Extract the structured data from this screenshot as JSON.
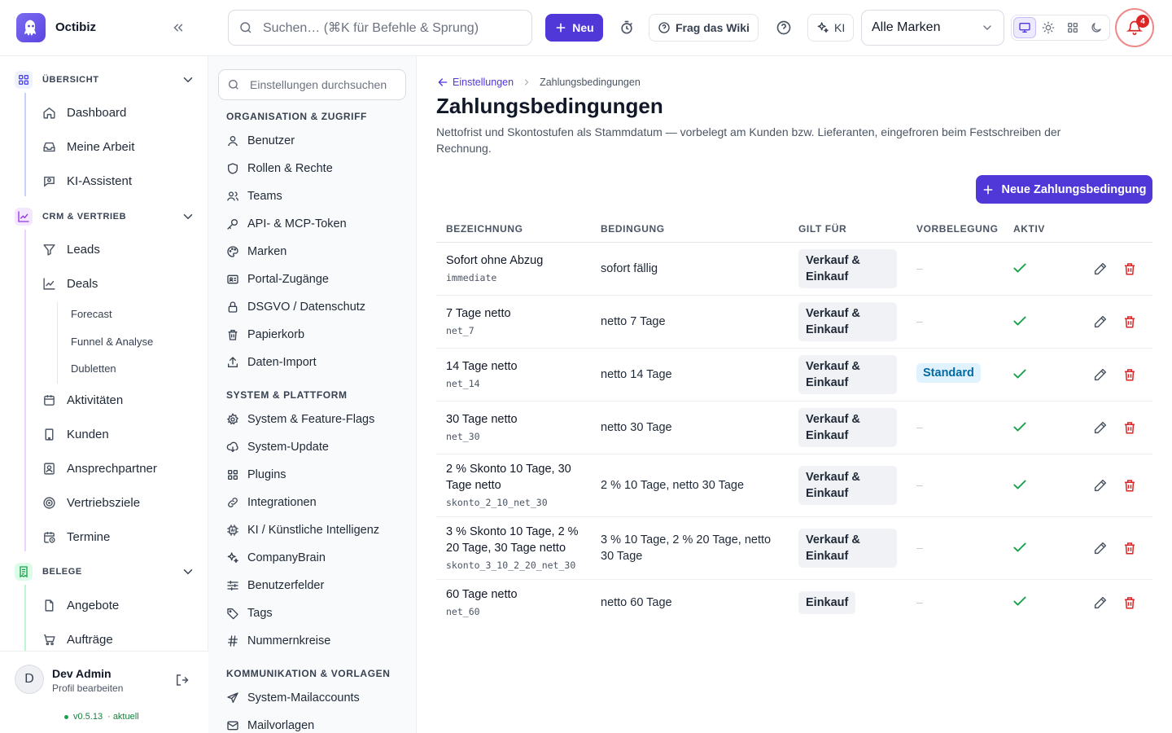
{
  "app": {
    "name": "Octibiz"
  },
  "topbar": {
    "search_placeholder": "Suchen… (⌘K für Befehle & Sprung)",
    "new_label": "Neu",
    "wiki_label": "Frag das Wiki",
    "ai_label": "KI",
    "brand_select": "Alle Marken",
    "notifications_count": "4"
  },
  "sidebar": {
    "sections": [
      {
        "label": "ÜBERSICHT",
        "items": [
          "Dashboard",
          "Meine Arbeit",
          "KI-Assistent"
        ]
      },
      {
        "label": "CRM & VERTRIEB",
        "items": [
          "Leads",
          "Deals",
          "Aktivitäten",
          "Kunden",
          "Ansprechpartner",
          "Vertriebsziele",
          "Termine"
        ],
        "deals_sub": [
          "Forecast",
          "Funnel & Analyse",
          "Dubletten"
        ]
      },
      {
        "label": "BELEGE",
        "items": [
          "Angebote",
          "Aufträge"
        ]
      }
    ],
    "profile": {
      "initial": "D",
      "name": "Dev Admin",
      "sub": "Profil bearbeiten",
      "version": "v0.5.13",
      "version_status": "· aktuell"
    }
  },
  "settings_nav": {
    "search_placeholder": "Einstellungen durchsuchen",
    "groups": [
      {
        "label": "ORGANISATION & ZUGRIFF",
        "items": [
          "Benutzer",
          "Rollen & Rechte",
          "Teams",
          "API- & MCP-Token",
          "Marken",
          "Portal-Zugänge",
          "DSGVO / Datenschutz",
          "Papierkorb",
          "Daten-Import"
        ]
      },
      {
        "label": "SYSTEM & PLATTFORM",
        "items": [
          "System & Feature-Flags",
          "System-Update",
          "Plugins",
          "Integrationen",
          "KI / Künstliche Intelligenz",
          "CompanyBrain",
          "Benutzerfelder",
          "Tags",
          "Nummernkreise"
        ]
      },
      {
        "label": "KOMMUNIKATION & VORLAGEN",
        "items": [
          "System-Mailaccounts",
          "Mailvorlagen"
        ]
      }
    ]
  },
  "main": {
    "breadcrumb": {
      "parent": "Einstellungen",
      "current": "Zahlungsbedingungen"
    },
    "title": "Zahlungsbedingungen",
    "description": "Nettofrist und Skontostufen als Stammdatum — vorbelegt am Kunden bzw. Lieferanten, eingefroren beim Festschreiben der Rechnung.",
    "new_button": "Neue Zahlungsbedingung",
    "columns": [
      "BEZEICHNUNG",
      "BEDINGUNG",
      "GILT FÜR",
      "VORBELEGUNG",
      "AKTIV"
    ],
    "rows": [
      {
        "name": "Sofort ohne Abzug",
        "code": "immediate",
        "condition": "sofort fällig",
        "scope": "Verkauf & Einkauf",
        "default": "–"
      },
      {
        "name": "7 Tage netto",
        "code": "net_7",
        "condition": "netto 7 Tage",
        "scope": "Verkauf & Einkauf",
        "default": "–"
      },
      {
        "name": "14 Tage netto",
        "code": "net_14",
        "condition": "netto 14 Tage",
        "scope": "Verkauf & Einkauf",
        "default": "Standard"
      },
      {
        "name": "30 Tage netto",
        "code": "net_30",
        "condition": "netto 30 Tage",
        "scope": "Verkauf & Einkauf",
        "default": "–"
      },
      {
        "name": "2 % Skonto 10 Tage, 30 Tage netto",
        "code": "skonto_2_10_net_30",
        "condition": "2 % 10 Tage, netto 30 Tage",
        "scope": "Verkauf & Einkauf",
        "default": "–"
      },
      {
        "name": "3 % Skonto 10 Tage, 2 % 20 Tage, 30 Tage netto",
        "code": "skonto_3_10_2_20_net_30",
        "condition": "3 % 10 Tage, 2 % 20 Tage, netto 30 Tage",
        "scope": "Verkauf & Einkauf",
        "default": "–"
      },
      {
        "name": "60 Tage netto",
        "code": "net_60",
        "condition": "netto 60 Tage",
        "scope": "Einkauf",
        "default": "–"
      }
    ]
  },
  "colors": {
    "accent": "#4f37d8",
    "success": "#16a34a",
    "danger": "#dc2626",
    "badge_bg": "#e0f2fe",
    "badge_fg": "#0369a1"
  }
}
